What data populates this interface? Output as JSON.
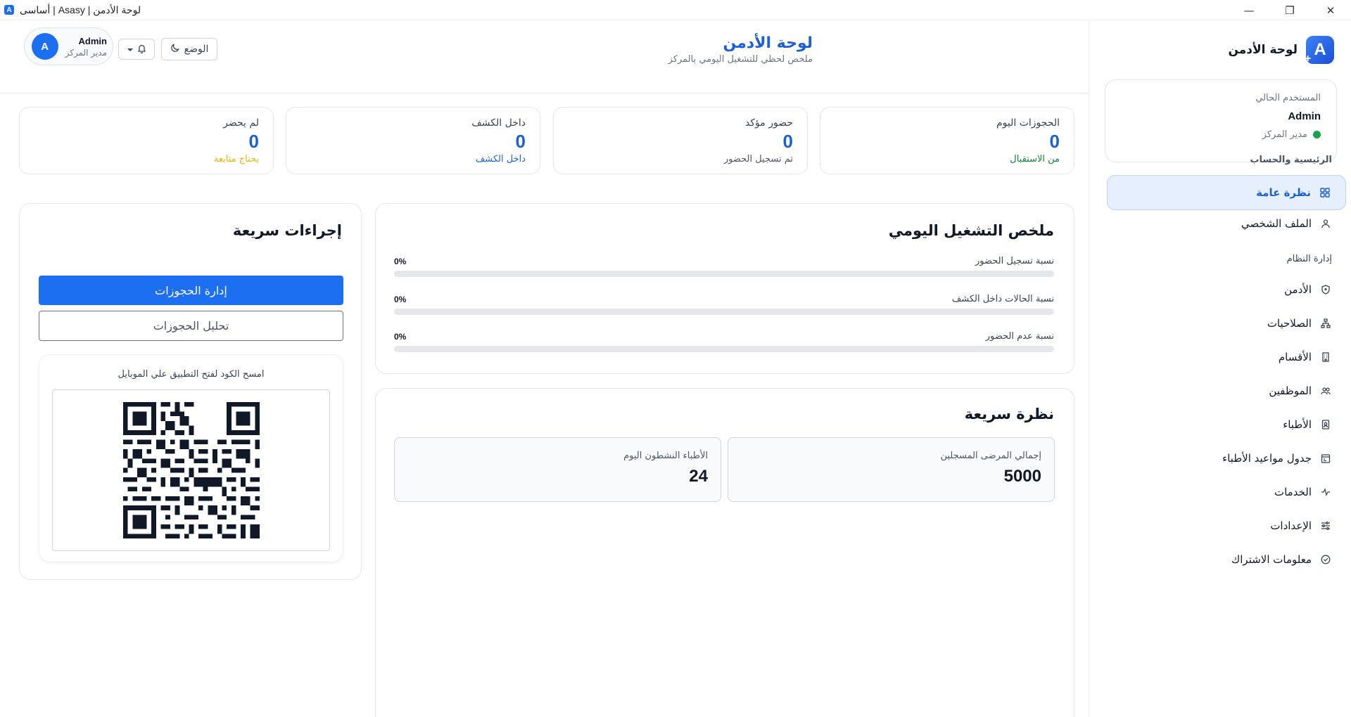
{
  "window": {
    "title": "أساسى | Asasy | لوحة الأدمن",
    "app_icon": "A",
    "min": "—",
    "max": "❐",
    "close": "✕"
  },
  "sidebar": {
    "brand": "لوحة الأدمن",
    "brand_logo": "A",
    "brand_plus": "+",
    "user_card": {
      "label": "المستخدم الحالي",
      "name": "Admin",
      "role": "مدير المركز"
    },
    "sections": {
      "home": "الرئيسية والحساب",
      "system": "إدارة النظام"
    },
    "items": [
      {
        "label": "نظرة عامة",
        "icon": "grid-icon"
      },
      {
        "label": "الملف الشخصي",
        "icon": "user-icon"
      },
      {
        "label": "الأدمن",
        "icon": "shield-icon"
      },
      {
        "label": "الصلاحيات",
        "icon": "hierarchy-icon"
      },
      {
        "label": "الأقسام",
        "icon": "building-icon"
      },
      {
        "label": "الموظفين",
        "icon": "users-icon"
      },
      {
        "label": "الأطباء",
        "icon": "badge-icon"
      },
      {
        "label": "جدول مواعيد الأطباء",
        "icon": "calendar-icon"
      },
      {
        "label": "الخدمات",
        "icon": "pulse-icon"
      },
      {
        "label": "الإعدادات",
        "icon": "sliders-icon"
      },
      {
        "label": "معلومات الاشتراك",
        "icon": "check-circle-icon"
      }
    ]
  },
  "header": {
    "title": "لوحة الأدمن",
    "subtitle": "ملخص لحظي للتشغيل اليومي بالمركز",
    "user": {
      "avatar": "A",
      "name": "Admin",
      "role": "مدير المركز"
    },
    "mode_label": "الوضع"
  },
  "stats": [
    {
      "label": "الحجوزات اليوم",
      "value": "0",
      "foot": "من الاستقبال",
      "foot_color": "#15803d"
    },
    {
      "label": "حضور مؤكد",
      "value": "0",
      "foot": "تم تسجيل الحضور",
      "foot_color": "#4b5563"
    },
    {
      "label": "داخل الكشف",
      "value": "0",
      "foot": "داخل الكشف",
      "foot_color": "#1d5fd6"
    },
    {
      "label": "لم يحضر",
      "value": "0",
      "foot": "يحتاج متابعة",
      "foot_color": "#eab308"
    }
  ],
  "daily_summary": {
    "title": "ملخص التشغيل اليومي",
    "rows": [
      {
        "label": "نسبة تسجيل الحضور",
        "value": "0%",
        "percent": 0
      },
      {
        "label": "نسبة الحالات داخل الكشف",
        "value": "0%",
        "percent": 0
      },
      {
        "label": "نسبة عدم الحضور",
        "value": "0%",
        "percent": 0
      }
    ]
  },
  "quick_view": {
    "title": "نظرة سريعة",
    "cards": [
      {
        "label": "إجمالي المرضى المسجلين",
        "value": "5000"
      },
      {
        "label": "الأطباء النشطون اليوم",
        "value": "24"
      }
    ]
  },
  "quick_actions": {
    "title": "إجراءات سريعة",
    "primary": "إدارة الحجوزات",
    "secondary": "تحليل الحجوزات",
    "qr_caption": "امسح الكود لفتح التطبيق علي الموبايل"
  },
  "colors": {
    "accent": "#1d6ff2",
    "accent_dark": "#1d5fd6",
    "success": "#16a34a",
    "warning": "#eab308"
  }
}
